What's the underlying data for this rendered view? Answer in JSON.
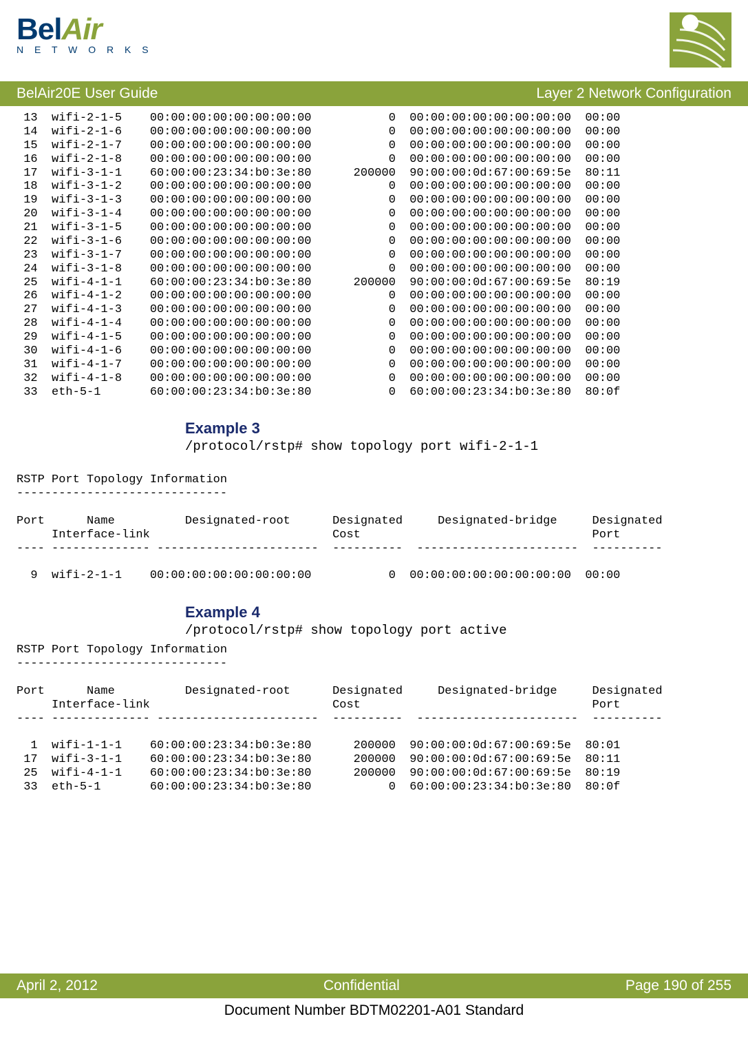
{
  "brand": {
    "name_part1": "Bel",
    "name_part2": "Air",
    "subtitle": "N E T W O R K S"
  },
  "header": {
    "left": "BelAir20E User Guide",
    "right": "Layer 2 Network Configuration"
  },
  "table1": {
    "rows": [
      {
        "p": " 13",
        "n": "wifi-2-1-5",
        "r": "00:00:00:00:00:00:00:00",
        "c": "     0",
        "b": "00:00:00:00:00:00:00:00",
        "dp": "00:00"
      },
      {
        "p": " 14",
        "n": "wifi-2-1-6",
        "r": "00:00:00:00:00:00:00:00",
        "c": "     0",
        "b": "00:00:00:00:00:00:00:00",
        "dp": "00:00"
      },
      {
        "p": " 15",
        "n": "wifi-2-1-7",
        "r": "00:00:00:00:00:00:00:00",
        "c": "     0",
        "b": "00:00:00:00:00:00:00:00",
        "dp": "00:00"
      },
      {
        "p": " 16",
        "n": "wifi-2-1-8",
        "r": "00:00:00:00:00:00:00:00",
        "c": "     0",
        "b": "00:00:00:00:00:00:00:00",
        "dp": "00:00"
      },
      {
        "p": " 17",
        "n": "wifi-3-1-1",
        "r": "60:00:00:23:34:b0:3e:80",
        "c": "200000",
        "b": "90:00:00:0d:67:00:69:5e",
        "dp": "80:11"
      },
      {
        "p": " 18",
        "n": "wifi-3-1-2",
        "r": "00:00:00:00:00:00:00:00",
        "c": "     0",
        "b": "00:00:00:00:00:00:00:00",
        "dp": "00:00"
      },
      {
        "p": " 19",
        "n": "wifi-3-1-3",
        "r": "00:00:00:00:00:00:00:00",
        "c": "     0",
        "b": "00:00:00:00:00:00:00:00",
        "dp": "00:00"
      },
      {
        "p": " 20",
        "n": "wifi-3-1-4",
        "r": "00:00:00:00:00:00:00:00",
        "c": "     0",
        "b": "00:00:00:00:00:00:00:00",
        "dp": "00:00"
      },
      {
        "p": " 21",
        "n": "wifi-3-1-5",
        "r": "00:00:00:00:00:00:00:00",
        "c": "     0",
        "b": "00:00:00:00:00:00:00:00",
        "dp": "00:00"
      },
      {
        "p": " 22",
        "n": "wifi-3-1-6",
        "r": "00:00:00:00:00:00:00:00",
        "c": "     0",
        "b": "00:00:00:00:00:00:00:00",
        "dp": "00:00"
      },
      {
        "p": " 23",
        "n": "wifi-3-1-7",
        "r": "00:00:00:00:00:00:00:00",
        "c": "     0",
        "b": "00:00:00:00:00:00:00:00",
        "dp": "00:00"
      },
      {
        "p": " 24",
        "n": "wifi-3-1-8",
        "r": "00:00:00:00:00:00:00:00",
        "c": "     0",
        "b": "00:00:00:00:00:00:00:00",
        "dp": "00:00"
      },
      {
        "p": " 25",
        "n": "wifi-4-1-1",
        "r": "60:00:00:23:34:b0:3e:80",
        "c": "200000",
        "b": "90:00:00:0d:67:00:69:5e",
        "dp": "80:19"
      },
      {
        "p": " 26",
        "n": "wifi-4-1-2",
        "r": "00:00:00:00:00:00:00:00",
        "c": "     0",
        "b": "00:00:00:00:00:00:00:00",
        "dp": "00:00"
      },
      {
        "p": " 27",
        "n": "wifi-4-1-3",
        "r": "00:00:00:00:00:00:00:00",
        "c": "     0",
        "b": "00:00:00:00:00:00:00:00",
        "dp": "00:00"
      },
      {
        "p": " 28",
        "n": "wifi-4-1-4",
        "r": "00:00:00:00:00:00:00:00",
        "c": "     0",
        "b": "00:00:00:00:00:00:00:00",
        "dp": "00:00"
      },
      {
        "p": " 29",
        "n": "wifi-4-1-5",
        "r": "00:00:00:00:00:00:00:00",
        "c": "     0",
        "b": "00:00:00:00:00:00:00:00",
        "dp": "00:00"
      },
      {
        "p": " 30",
        "n": "wifi-4-1-6",
        "r": "00:00:00:00:00:00:00:00",
        "c": "     0",
        "b": "00:00:00:00:00:00:00:00",
        "dp": "00:00"
      },
      {
        "p": " 31",
        "n": "wifi-4-1-7",
        "r": "00:00:00:00:00:00:00:00",
        "c": "     0",
        "b": "00:00:00:00:00:00:00:00",
        "dp": "00:00"
      },
      {
        "p": " 32",
        "n": "wifi-4-1-8",
        "r": "00:00:00:00:00:00:00:00",
        "c": "     0",
        "b": "00:00:00:00:00:00:00:00",
        "dp": "00:00"
      },
      {
        "p": " 33",
        "n": "eth-5-1   ",
        "r": "60:00:00:23:34:b0:3e:80",
        "c": "     0",
        "b": "60:00:00:23:34:b0:3e:80",
        "dp": "80:0f"
      }
    ]
  },
  "example3": {
    "title": "Example 3",
    "cmd": "/protocol/rstp# show topology port wifi-2-1-1",
    "info_title": "RSTP Port Topology Information",
    "info_dash": "------------------------------",
    "hdr1": "Port      Name          Designated-root      Designated     Designated-bridge     Designated",
    "hdr2": "     Interface-link                          Cost                                 Port",
    "hdr3": "---- -------------- -----------------------  ----------  -----------------------  ----------",
    "rows": [
      {
        "p": "  9",
        "n": "wifi-2-1-1",
        "r": "00:00:00:00:00:00:00:00",
        "c": "     0",
        "b": "00:00:00:00:00:00:00:00",
        "dp": "00:00"
      }
    ]
  },
  "example4": {
    "title": "Example 4",
    "cmd": "/protocol/rstp# show topology port active",
    "info_title": "RSTP Port Topology Information",
    "info_dash": "------------------------------",
    "hdr1": "Port      Name          Designated-root      Designated     Designated-bridge     Designated",
    "hdr2": "     Interface-link                          Cost                                 Port",
    "hdr3": "---- -------------- -----------------------  ----------  -----------------------  ----------",
    "rows": [
      {
        "p": "  1",
        "n": "wifi-1-1-1",
        "r": "60:00:00:23:34:b0:3e:80",
        "c": "200000",
        "b": "90:00:00:0d:67:00:69:5e",
        "dp": "80:01"
      },
      {
        "p": " 17",
        "n": "wifi-3-1-1",
        "r": "60:00:00:23:34:b0:3e:80",
        "c": "200000",
        "b": "90:00:00:0d:67:00:69:5e",
        "dp": "80:11"
      },
      {
        "p": " 25",
        "n": "wifi-4-1-1",
        "r": "60:00:00:23:34:b0:3e:80",
        "c": "200000",
        "b": "90:00:00:0d:67:00:69:5e",
        "dp": "80:19"
      },
      {
        "p": " 33",
        "n": "eth-5-1   ",
        "r": "60:00:00:23:34:b0:3e:80",
        "c": "     0",
        "b": "60:00:00:23:34:b0:3e:80",
        "dp": "80:0f"
      }
    ]
  },
  "footer": {
    "left": "April 2, 2012",
    "center": "Confidential",
    "right": "Page 190 of 255",
    "docnum": "Document Number BDTM02201-A01 Standard"
  }
}
